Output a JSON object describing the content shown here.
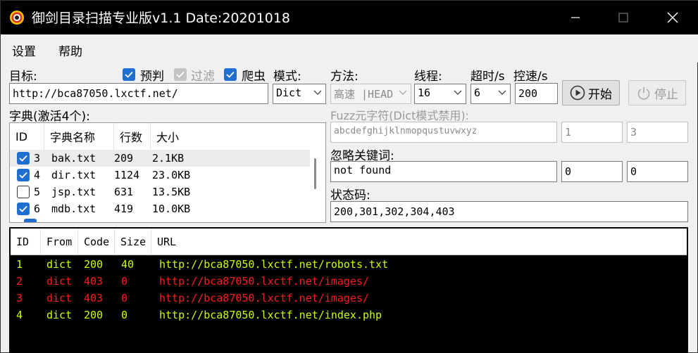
{
  "window": {
    "title": "御剑目录扫描专业版v1.1 Date:20201018"
  },
  "menu": [
    "设置",
    "帮助"
  ],
  "target": {
    "label": "目标:",
    "value": "http://bca87050.lxctf.net/"
  },
  "options": {
    "precheck": {
      "label": "预判",
      "checked": true
    },
    "filter": {
      "label": "过滤",
      "checked": true,
      "disabled": true
    },
    "crawler": {
      "label": "爬虫",
      "checked": true
    }
  },
  "mode": {
    "label": "模式:",
    "value": "Dict"
  },
  "method": {
    "label": "方法:",
    "value": "高速 |HEAD"
  },
  "threads": {
    "label": "线程:",
    "value": "16"
  },
  "timeout": {
    "label": "超时/s",
    "value": "6"
  },
  "rate": {
    "label": "控速/s",
    "value": "200"
  },
  "buttons": {
    "start": "开始",
    "stop": "停止"
  },
  "dict": {
    "label": "字典(激活4个):",
    "columns": [
      "ID",
      "字典名称",
      "行数",
      "大小"
    ],
    "rows": [
      {
        "id": "3",
        "name": "bak.txt",
        "lines": "209",
        "size": "2.1KB",
        "checked": true
      },
      {
        "id": "4",
        "name": "dir.txt",
        "lines": "1124",
        "size": "23.0KB",
        "checked": true
      },
      {
        "id": "5",
        "name": "jsp.txt",
        "lines": "631",
        "size": "13.5KB",
        "checked": false
      },
      {
        "id": "6",
        "name": "mdb.txt",
        "lines": "419",
        "size": "10.0KB",
        "checked": true
      }
    ]
  },
  "fuzz": {
    "label": "Fuzz元字符(Dict模式禁用):",
    "chars": "abcdefghijklnmopqustuvwxyz",
    "min": "1",
    "max": "3"
  },
  "ignore": {
    "label": "忽略关键词:",
    "value": "not found",
    "v1": "0",
    "v2": "0"
  },
  "status": {
    "label": "状态码:",
    "value": "200,301,302,304,403"
  },
  "results": {
    "columns": [
      "ID",
      "From",
      "Code",
      "Size",
      "URL"
    ],
    "rows": [
      {
        "id": "1",
        "from": "dict",
        "code": "200",
        "size": "40",
        "url": "http://bca87050.lxctf.net/robots.txt",
        "color": "#c8ff00"
      },
      {
        "id": "2",
        "from": "dict",
        "code": "403",
        "size": "0",
        "url": "http://bca87050.lxctf.net/images/",
        "color": "#ff1a1a"
      },
      {
        "id": "3",
        "from": "dict",
        "code": "403",
        "size": "0",
        "url": "http://bca87050.lxctf.net/images/",
        "color": "#ff1a1a"
      },
      {
        "id": "4",
        "from": "dict",
        "code": "200",
        "size": "0",
        "url": "http://bca87050.lxctf.net/index.php",
        "color": "#c8ff00"
      }
    ]
  }
}
